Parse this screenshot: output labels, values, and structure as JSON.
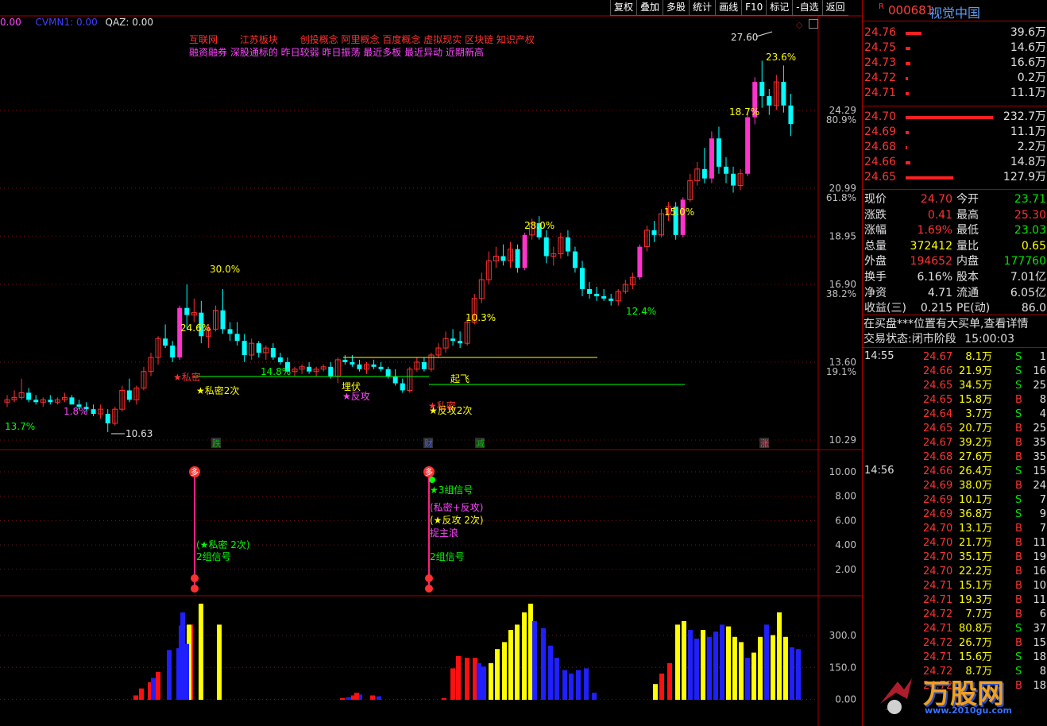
{
  "indicator_line": {
    "label1": "CVMN1:",
    "v1": "0.00",
    "label2": "QAZ:",
    "v2": "0.00",
    "lead": "0.00"
  },
  "concepts": {
    "line1": [
      "互联网",
      "江苏板块",
      "创投概念",
      "阿里概念",
      "百度概念",
      "虚拟现实",
      "区块链",
      "知识产权"
    ],
    "line2": "融资融券 深股通标的 昨日较弱 昨日振荡 最近多板 最近异动 近期新高"
  },
  "toolbar": [
    "复权",
    "叠加",
    "多股",
    "统计",
    "画线",
    "F10",
    "标记",
    "-自选",
    "返回"
  ],
  "stock": {
    "code": "000681",
    "name": "视觉中国",
    "badge": "R"
  },
  "price_axis": [
    {
      "price": "24.29",
      "pct": "80.9%"
    },
    {
      "price": "20.99",
      "pct": "61.8%"
    },
    {
      "price": "18.95",
      "pct": ""
    },
    {
      "price": "16.90",
      "pct": "38.2%"
    },
    {
      "price": "13.60",
      "pct": "19.1%"
    },
    {
      "price": "10.29",
      "pct": ""
    }
  ],
  "signal_axis": [
    "10.00",
    "8.00",
    "6.00",
    "4.00",
    "2.00"
  ],
  "volume_axis": [
    "300.0",
    "150.0",
    "0.00"
  ],
  "chart_labels": {
    "high": "27.60",
    "low": "10.63",
    "pcts": [
      "13.7%",
      "1.8%",
      "24.6%",
      "30.0%",
      "14.8%",
      "10.3%",
      "28.0%",
      "12.4%",
      "15.0%",
      "18.7%",
      "23.6%"
    ],
    "annotations": [
      "★私密",
      "★私密2次",
      "埋伏",
      "★反攻",
      "★私密",
      "★反攻2次",
      "起飞"
    ],
    "markers": [
      "跌",
      "财",
      "减",
      "涨"
    ]
  },
  "signals": {
    "marker": "多",
    "left": [
      "(★私密 2次)",
      "2组信号"
    ],
    "right": [
      "★3组信号",
      "(私密+反攻)",
      "(★反攻 2次)",
      "捉主浪",
      "2组信号"
    ]
  },
  "chart_data": {
    "type": "candlestick",
    "yrange": [
      10.29,
      27.6
    ],
    "candles": [
      [
        11.9,
        12.2,
        11.7,
        12.0
      ],
      [
        12.0,
        12.4,
        11.9,
        12.1
      ],
      [
        12.1,
        12.9,
        12.0,
        12.3
      ],
      [
        12.3,
        12.5,
        11.9,
        12.0
      ],
      [
        12.0,
        12.2,
        11.8,
        11.9
      ],
      [
        11.9,
        12.1,
        11.7,
        12.0
      ],
      [
        12.0,
        12.2,
        11.8,
        11.9
      ],
      [
        11.9,
        12.1,
        11.8,
        12.0
      ],
      [
        12.0,
        12.3,
        11.9,
        12.1
      ],
      [
        12.1,
        12.2,
        11.8,
        11.8
      ],
      [
        11.8,
        12.0,
        11.6,
        11.7
      ],
      [
        11.7,
        11.9,
        11.5,
        11.6
      ],
      [
        11.6,
        11.8,
        11.3,
        11.4
      ],
      [
        11.4,
        11.8,
        11.2,
        11.6
      ],
      [
        11.4,
        11.6,
        10.63,
        11.0
      ],
      [
        11.0,
        11.7,
        10.9,
        11.6
      ],
      [
        11.6,
        12.6,
        11.5,
        12.4
      ],
      [
        12.4,
        12.9,
        11.9,
        12.0
      ],
      [
        12.0,
        12.6,
        11.8,
        12.5
      ],
      [
        12.5,
        13.4,
        12.4,
        13.2
      ],
      [
        13.2,
        14.0,
        13.0,
        13.8
      ],
      [
        13.8,
        14.7,
        13.5,
        14.6
      ],
      [
        14.6,
        15.2,
        14.2,
        14.3
      ],
      [
        14.3,
        14.5,
        13.6,
        13.8
      ],
      [
        13.8,
        16.0,
        13.7,
        15.9
      ],
      [
        15.9,
        16.9,
        15.0,
        15.6
      ],
      [
        15.6,
        16.3,
        15.3,
        15.7
      ],
      [
        15.7,
        16.2,
        14.4,
        14.7
      ],
      [
        14.7,
        15.2,
        14.2,
        15.0
      ],
      [
        15.0,
        16.0,
        14.9,
        15.8
      ],
      [
        15.8,
        16.7,
        14.8,
        15.0
      ],
      [
        15.0,
        15.3,
        14.5,
        14.8
      ],
      [
        14.8,
        15.3,
        14.3,
        14.5
      ],
      [
        14.5,
        14.8,
        13.6,
        13.9
      ],
      [
        13.9,
        14.6,
        13.7,
        14.4
      ],
      [
        14.4,
        14.5,
        13.8,
        14.0
      ],
      [
        14.0,
        14.3,
        13.7,
        14.2
      ],
      [
        14.2,
        14.4,
        13.7,
        13.8
      ],
      [
        13.8,
        14.0,
        13.5,
        13.6
      ],
      [
        13.6,
        13.8,
        13.1,
        13.2
      ],
      [
        13.2,
        13.4,
        13.0,
        13.3
      ],
      [
        13.3,
        13.5,
        13.1,
        13.4
      ],
      [
        13.4,
        13.6,
        13.1,
        13.2
      ],
      [
        13.2,
        13.4,
        13.0,
        13.3
      ],
      [
        13.3,
        13.5,
        13.2,
        13.4
      ],
      [
        13.4,
        13.6,
        12.9,
        13.0
      ],
      [
        13.0,
        13.8,
        12.7,
        13.7
      ],
      [
        13.7,
        13.9,
        13.5,
        13.6
      ],
      [
        13.6,
        13.9,
        13.4,
        13.5
      ],
      [
        13.5,
        13.7,
        13.2,
        13.3
      ],
      [
        13.3,
        13.6,
        13.1,
        13.5
      ],
      [
        13.5,
        13.7,
        13.3,
        13.4
      ],
      [
        13.4,
        13.6,
        13.2,
        13.3
      ],
      [
        13.3,
        13.4,
        12.9,
        13.0
      ],
      [
        13.0,
        13.3,
        12.6,
        12.7
      ],
      [
        12.7,
        12.9,
        12.3,
        12.4
      ],
      [
        12.4,
        13.4,
        12.3,
        13.3
      ],
      [
        13.3,
        13.8,
        13.2,
        13.6
      ],
      [
        13.6,
        13.8,
        13.2,
        13.3
      ],
      [
        13.3,
        14.0,
        13.2,
        13.9
      ],
      [
        13.9,
        14.4,
        13.8,
        14.2
      ],
      [
        14.2,
        14.9,
        14.0,
        14.6
      ],
      [
        14.6,
        15.0,
        14.3,
        14.5
      ],
      [
        14.5,
        14.9,
        14.2,
        14.4
      ],
      [
        14.4,
        15.5,
        14.3,
        15.3
      ],
      [
        15.3,
        16.5,
        15.2,
        16.3
      ],
      [
        16.3,
        17.4,
        16.1,
        17.1
      ],
      [
        17.1,
        18.3,
        16.9,
        17.9
      ],
      [
        17.9,
        18.5,
        17.6,
        18.1
      ],
      [
        18.1,
        18.6,
        17.7,
        17.9
      ],
      [
        17.9,
        18.7,
        17.6,
        18.4
      ],
      [
        18.4,
        18.6,
        17.4,
        17.6
      ],
      [
        17.6,
        19.1,
        17.5,
        19.0
      ],
      [
        19.0,
        19.7,
        18.8,
        19.5
      ],
      [
        19.5,
        19.8,
        18.8,
        18.9
      ],
      [
        18.9,
        19.2,
        17.8,
        18.1
      ],
      [
        18.1,
        18.5,
        17.7,
        18.2
      ],
      [
        18.2,
        19.1,
        18.0,
        18.9
      ],
      [
        18.9,
        19.2,
        18.1,
        18.3
      ],
      [
        18.3,
        18.5,
        17.4,
        17.6
      ],
      [
        17.6,
        17.9,
        16.4,
        16.7
      ],
      [
        16.7,
        17.0,
        16.3,
        16.5
      ],
      [
        16.5,
        16.8,
        16.2,
        16.4
      ],
      [
        16.4,
        16.7,
        16.2,
        16.3
      ],
      [
        16.3,
        16.5,
        16.0,
        16.2
      ],
      [
        16.2,
        16.7,
        16.0,
        16.6
      ],
      [
        16.6,
        17.1,
        16.5,
        16.9
      ],
      [
        16.9,
        17.4,
        16.7,
        17.2
      ],
      [
        17.2,
        18.6,
        17.1,
        18.5
      ],
      [
        18.5,
        19.4,
        18.3,
        19.2
      ],
      [
        19.2,
        19.6,
        18.7,
        19.0
      ],
      [
        19.0,
        20.1,
        18.9,
        19.9
      ],
      [
        19.9,
        20.4,
        19.6,
        20.2
      ],
      [
        20.2,
        20.4,
        18.8,
        19.0
      ],
      [
        19.0,
        20.6,
        18.9,
        20.5
      ],
      [
        20.5,
        21.6,
        20.4,
        21.3
      ],
      [
        21.3,
        22.1,
        21.1,
        21.8
      ],
      [
        21.8,
        22.7,
        21.2,
        21.4
      ],
      [
        21.4,
        23.4,
        21.2,
        23.1
      ],
      [
        23.1,
        23.6,
        21.6,
        21.9
      ],
      [
        21.9,
        22.3,
        21.2,
        21.6
      ],
      [
        21.6,
        21.9,
        20.8,
        21.1
      ],
      [
        21.1,
        21.8,
        20.9,
        21.6
      ],
      [
        21.6,
        24.2,
        21.5,
        24.0
      ],
      [
        24.0,
        25.7,
        23.7,
        25.5
      ],
      [
        25.5,
        26.4,
        24.4,
        24.9
      ],
      [
        24.9,
        25.2,
        24.1,
        24.5
      ],
      [
        24.5,
        25.8,
        24.3,
        25.5
      ],
      [
        25.5,
        26.2,
        24.2,
        24.5
      ],
      [
        24.5,
        25.0,
        23.2,
        23.71
      ]
    ],
    "volume": [
      [
        168,
        "r"
      ],
      [
        175,
        "r"
      ],
      [
        186,
        "r"
      ],
      [
        196,
        "r"
      ],
      [
        210,
        "r"
      ],
      [
        226,
        "r"
      ],
      [
        237,
        "r"
      ],
      [
        250,
        "r"
      ],
      [
        225,
        "b"
      ],
      [
        227,
        "b"
      ],
      [
        250,
        "y"
      ],
      [
        273,
        "y"
      ],
      [
        235,
        "y"
      ],
      [
        232,
        "b"
      ],
      [
        222,
        "b"
      ],
      [
        210,
        "b"
      ],
      [
        190,
        "b"
      ],
      [
        428,
        "r"
      ],
      [
        436,
        "b"
      ],
      [
        442,
        "r"
      ],
      [
        450,
        "b"
      ],
      [
        446,
        "r"
      ],
      [
        466,
        "r"
      ],
      [
        474,
        "b"
      ],
      [
        556,
        "r"
      ],
      [
        567,
        "r"
      ],
      [
        574,
        "r"
      ],
      [
        585,
        "r"
      ],
      [
        595,
        "r"
      ],
      [
        600,
        "b"
      ],
      [
        606,
        "b"
      ],
      [
        615,
        "y"
      ],
      [
        623,
        "y"
      ],
      [
        632,
        "y"
      ],
      [
        640,
        "y"
      ],
      [
        648,
        "y"
      ],
      [
        657,
        "y"
      ],
      [
        665,
        "y"
      ],
      [
        670,
        "b"
      ],
      [
        681,
        "b"
      ],
      [
        690,
        "b"
      ],
      [
        698,
        "b"
      ],
      [
        708,
        "b"
      ],
      [
        716,
        "b"
      ],
      [
        725,
        "b"
      ],
      [
        735,
        "b"
      ],
      [
        745,
        "b"
      ],
      [
        822,
        "y"
      ],
      [
        830,
        "r"
      ],
      [
        840,
        "r"
      ],
      [
        850,
        "y"
      ],
      [
        858,
        "y"
      ],
      [
        866,
        "b"
      ],
      [
        874,
        "b"
      ],
      [
        882,
        "y"
      ],
      [
        890,
        "b"
      ],
      [
        898,
        "b"
      ],
      [
        906,
        "b"
      ],
      [
        914,
        "y"
      ],
      [
        922,
        "y"
      ],
      [
        930,
        "y"
      ],
      [
        938,
        "b"
      ],
      [
        946,
        "y"
      ],
      [
        954,
        "y"
      ],
      [
        962,
        "b"
      ],
      [
        970,
        "y"
      ],
      [
        978,
        "y"
      ],
      [
        986,
        "y"
      ],
      [
        994,
        "b"
      ],
      [
        1002,
        "b"
      ]
    ]
  },
  "quote": {
    "asks": [
      {
        "p": "24.76",
        "v": "39.6万",
        "bar": 20
      },
      {
        "p": "24.75",
        "v": "14.6万",
        "bar": 6
      },
      {
        "p": "24.73",
        "v": "16.6万",
        "bar": 6
      },
      {
        "p": "24.72",
        "v": "0.2万",
        "bar": 3
      },
      {
        "p": "24.71",
        "v": "11.1万",
        "bar": 4
      }
    ],
    "bids": [
      {
        "p": "24.70",
        "v": "232.7万",
        "bar": 110
      },
      {
        "p": "24.69",
        "v": "11.1万",
        "bar": 4
      },
      {
        "p": "24.68",
        "v": "2.2万",
        "bar": 2
      },
      {
        "p": "24.66",
        "v": "14.8万",
        "bar": 6
      },
      {
        "p": "24.65",
        "v": "127.9万",
        "bar": 60
      }
    ],
    "stats": [
      {
        "l": "现价",
        "v": "24.70",
        "vc": "red",
        "l2": "今开",
        "v2": "23.71",
        "v2c": "grn"
      },
      {
        "l": "涨跌",
        "v": "0.41",
        "vc": "red",
        "l2": "最高",
        "v2": "25.30",
        "v2c": "red"
      },
      {
        "l": "涨幅",
        "v": "1.69%",
        "vc": "red",
        "l2": "最低",
        "v2": "23.03",
        "v2c": "grn"
      },
      {
        "l": "总量",
        "v": "372412",
        "vc": "yel",
        "l2": "量比",
        "v2": "0.65",
        "v2c": "yel"
      },
      {
        "l": "外盘",
        "v": "194652",
        "vc": "red",
        "l2": "内盘",
        "v2": "177760",
        "v2c": "grn"
      },
      {
        "l": "换手",
        "v": "6.16%",
        "vc": "wht",
        "l2": "股本",
        "v2": "7.01亿",
        "v2c": "wht"
      },
      {
        "l": "净资",
        "v": "4.71",
        "vc": "wht",
        "l2": "流通",
        "v2": "6.05亿",
        "v2c": "wht"
      },
      {
        "l": "收益(三)",
        "v": "0.215",
        "vc": "wht",
        "l2": "PE(动)",
        "v2": "86.0",
        "v2c": "wht"
      }
    ],
    "notice": "在买盘***位置有大买单,查看详情",
    "status_label": "交易状态:",
    "status": "闭市阶段",
    "status_time": "15:00:03"
  },
  "ticks": {
    "block1_time": "14:55",
    "block1": [
      {
        "p": "24.67",
        "v": "8.1万",
        "s": "S",
        "n": "1"
      },
      {
        "p": "24.66",
        "v": "21.9万",
        "s": "S",
        "n": "16"
      },
      {
        "p": "24.65",
        "v": "34.5万",
        "s": "S",
        "n": "25"
      },
      {
        "p": "24.65",
        "v": "15.8万",
        "s": "B",
        "n": "8"
      },
      {
        "p": "24.64",
        "v": "3.7万",
        "s": "S",
        "n": "4"
      },
      {
        "p": "24.65",
        "v": "20.7万",
        "s": "B",
        "n": "25"
      },
      {
        "p": "24.67",
        "v": "39.2万",
        "s": "B",
        "n": "35"
      },
      {
        "p": "24.68",
        "v": "27.6万",
        "s": "B",
        "n": "35"
      }
    ],
    "block2_time": "14:56",
    "block2": [
      {
        "p": "24.66",
        "v": "26.4万",
        "s": "S",
        "n": "15"
      },
      {
        "p": "24.69",
        "v": "38.0万",
        "s": "B",
        "n": "24"
      },
      {
        "p": "24.69",
        "v": "10.1万",
        "s": "S",
        "n": "7"
      },
      {
        "p": "24.69",
        "v": "36.8万",
        "s": "S",
        "n": "9"
      },
      {
        "p": "24.70",
        "v": "13.1万",
        "s": "B",
        "n": "7"
      },
      {
        "p": "24.70",
        "v": "21.7万",
        "s": "B",
        "n": "11"
      },
      {
        "p": "24.70",
        "v": "35.1万",
        "s": "B",
        "n": "19"
      },
      {
        "p": "24.70",
        "v": "22.2万",
        "s": "B",
        "n": "16"
      },
      {
        "p": "24.71",
        "v": "15.1万",
        "s": "B",
        "n": "10"
      },
      {
        "p": "24.71",
        "v": "19.3万",
        "s": "B",
        "n": "11"
      },
      {
        "p": "24.72",
        "v": "7.7万",
        "s": "B",
        "n": "6"
      },
      {
        "p": "24.71",
        "v": "80.8万",
        "s": "S",
        "n": "37"
      },
      {
        "p": "24.72",
        "v": "26.7万",
        "s": "B",
        "n": "15"
      },
      {
        "p": "24.71",
        "v": "15.6万",
        "s": "S",
        "n": "18"
      },
      {
        "p": "24.72",
        "v": "8.7万",
        "s": "S",
        "n": "8"
      },
      {
        "p": "24.72",
        "v": "",
        "s": "B",
        "n": "18"
      }
    ]
  },
  "watermark": {
    "text": "万股网",
    "url": "www.2010gu.com"
  }
}
